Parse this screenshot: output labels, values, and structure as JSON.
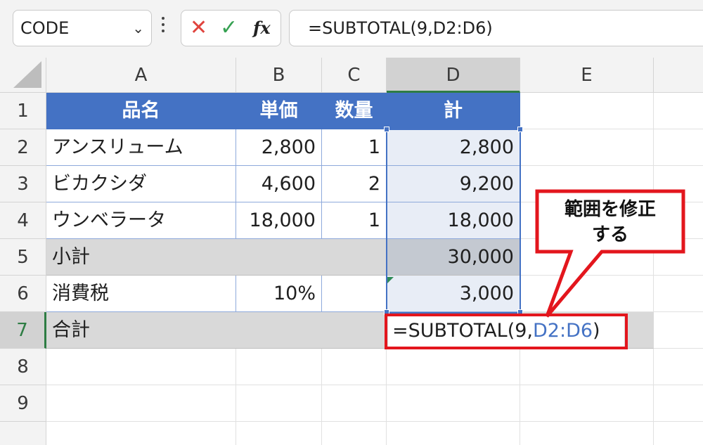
{
  "formula_bar": {
    "name_box": "CODE",
    "chevron": "⌄",
    "cancel_glyph": "✕",
    "enter_glyph": "✓",
    "fx_glyph": "fx",
    "formula": "=SUBTOTAL(9,D2:D6)"
  },
  "columns": [
    "A",
    "B",
    "C",
    "D",
    "E"
  ],
  "rows": [
    "1",
    "2",
    "3",
    "4",
    "5",
    "6",
    "7",
    "8",
    "9"
  ],
  "table": {
    "header": [
      "品名",
      "単価",
      "数量",
      "計"
    ],
    "items": [
      {
        "name": "アンスリューム",
        "price": "2,800",
        "qty": "1",
        "total": "2,800"
      },
      {
        "name": "ビカクシダ",
        "price": "4,600",
        "qty": "2",
        "total": "9,200"
      },
      {
        "name": "ウンベラータ",
        "price": "18,000",
        "qty": "1",
        "total": "18,000"
      }
    ],
    "subtotal": {
      "label": "小計",
      "total": "30,000"
    },
    "tax": {
      "label": "消費税",
      "rate": "10%",
      "total": "3,000"
    },
    "grand": {
      "label": "合計",
      "formula_prefix": "=SUBTOTAL(9,",
      "formula_ref": "D2:D6",
      "formula_suffix": ")"
    }
  },
  "callout": {
    "line1": "範囲を修正",
    "line2": "する"
  },
  "colors": {
    "header_fill": "#4472c4",
    "accent_red": "#e3161d",
    "select_green": "#2e7d44",
    "range_blue": "#4472c4"
  }
}
